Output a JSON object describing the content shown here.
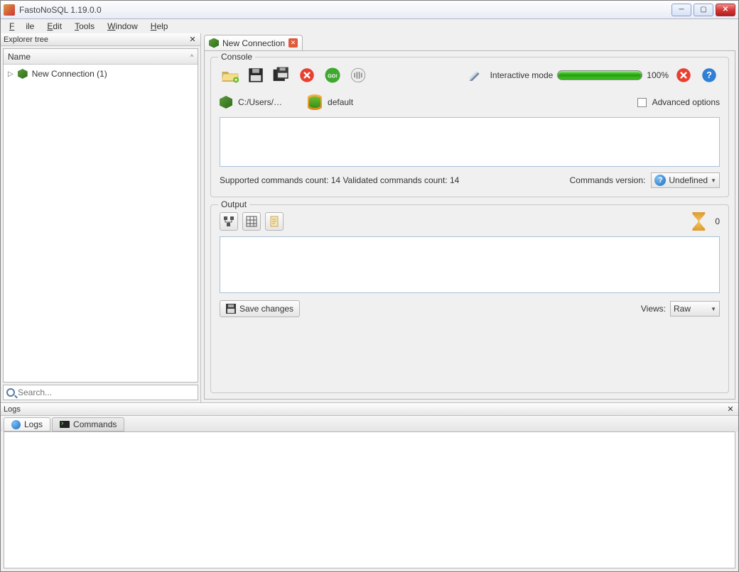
{
  "window": {
    "title": "FastoNoSQL 1.19.0.0"
  },
  "menu": {
    "file": "File",
    "edit": "Edit",
    "tools": "Tools",
    "window": "Window",
    "help": "Help"
  },
  "explorer": {
    "title": "Explorer tree",
    "column": "Name",
    "items": [
      {
        "label": "New Connection (1)"
      }
    ],
    "search_placeholder": "Search..."
  },
  "tab": {
    "label": "New Connection"
  },
  "console": {
    "group": "Console",
    "interactive_label": "Interactive mode",
    "progress": "100%",
    "path": "C:/Users/…",
    "db": "default",
    "advanced": "Advanced options",
    "supported": "Supported commands count: 14 Validated commands count: 14",
    "cmd_version_label": "Commands version:",
    "cmd_version_value": "Undefined"
  },
  "output": {
    "group": "Output",
    "count": "0",
    "save": "Save changes",
    "views_label": "Views:",
    "views_value": "Raw"
  },
  "logs": {
    "title": "Logs",
    "tab_logs": "Logs",
    "tab_commands": "Commands"
  }
}
